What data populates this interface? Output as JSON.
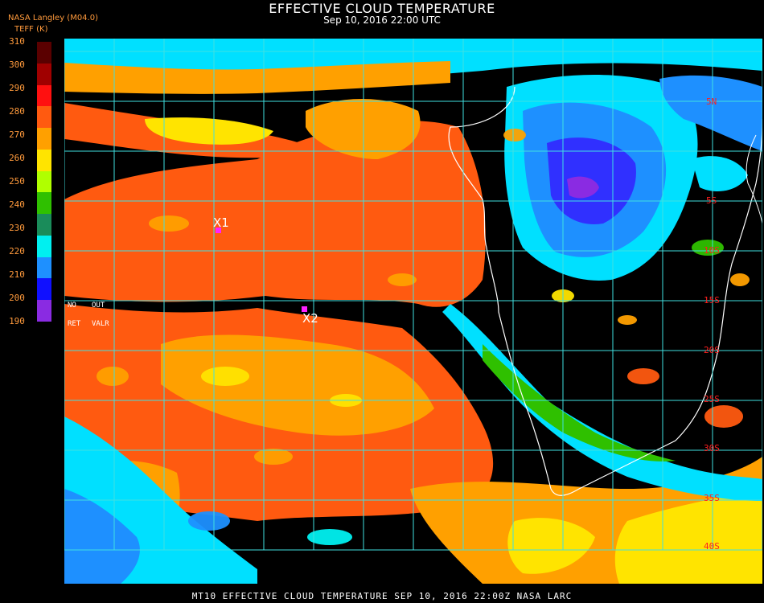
{
  "header": {
    "title": "EFFECTIVE CLOUD TEMPERATURE",
    "datetime": "Sep 10, 2016 22:00 UTC",
    "org": "NASA Langley (M04.0)",
    "units": "TEFF (K)"
  },
  "scale": {
    "ticks": [
      "310",
      "300",
      "290",
      "280",
      "270",
      "260",
      "250",
      "240",
      "230",
      "220",
      "210",
      "200",
      "190"
    ],
    "colors": [
      "#5a0000",
      "#a00000",
      "#ff1010",
      "#ff5a10",
      "#ffa000",
      "#ffe400",
      "#b0ff00",
      "#2fc000",
      "#1a8c5a",
      "#00f0f0",
      "#1e90ff",
      "#1010ff",
      "#8a2be2"
    ],
    "notes": [
      "NO",
      "OUT",
      "RET",
      "VALR"
    ]
  },
  "map": {
    "lat_labels": [
      "5N",
      "5S",
      "10S",
      "15S",
      "20S",
      "25S",
      "30S",
      "35S",
      "40S"
    ],
    "markers": [
      {
        "label": "X1"
      },
      {
        "label": "X2"
      }
    ],
    "colors": {
      "grid": "#40e0e0",
      "coast": "#ffffff",
      "deep_convection": "#3030ff",
      "low_warm": "#ff5a10",
      "mid": "#ffa000",
      "cold": "#00e0ff",
      "clear": "#000000"
    }
  },
  "footer": {
    "text": "MT10  EFFECTIVE CLOUD TEMPERATURE   SEP 10, 2016 22:00Z   NASA LARC"
  }
}
